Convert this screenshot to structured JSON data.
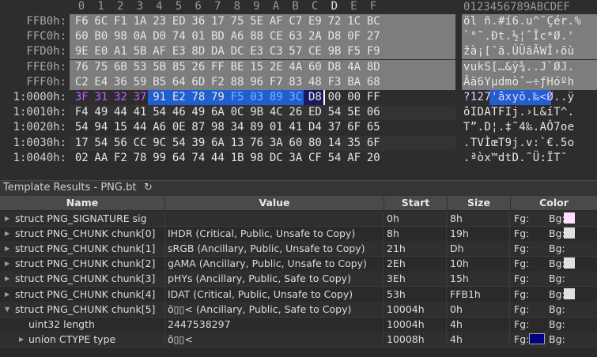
{
  "hex_header": {
    "columns": [
      "0",
      "1",
      "2",
      "3",
      "4",
      "5",
      "6",
      "7",
      "8",
      "9",
      "A",
      "B",
      "C",
      "D",
      "E",
      "F"
    ],
    "ascii_header": "0123456789ABCDEF"
  },
  "hex_rows": [
    {
      "addr": "FFB0h:",
      "bytes": [
        "F6",
        "6C",
        "F1",
        "1A",
        "23",
        "ED",
        "36",
        "17",
        "75",
        "5E",
        "AF",
        "C7",
        "E9",
        "72",
        "1C",
        "BC"
      ],
      "ascii": "öl ñ.#í6.u^¯Çér.%"
    },
    {
      "addr": "FFC0h:",
      "bytes": [
        "60",
        "B0",
        "98",
        "0A",
        "D0",
        "74",
        "01",
        "BD",
        "A6",
        "88",
        "CE",
        "63",
        "2A",
        "D8",
        "0F",
        "27"
      ],
      "ascii": "`°˜.Ðt.½¦ˆÎc*Ø.'"
    },
    {
      "addr": "FFD0h:",
      "bytes": [
        "9E",
        "E0",
        "A1",
        "5B",
        "AF",
        "E3",
        "8D",
        "DA",
        "DC",
        "E3",
        "C3",
        "57",
        "CE",
        "9B",
        "F5",
        "F9"
      ],
      "ascii": "žà¡[¯ã.ÚÜãÃWÎ›õù"
    },
    {
      "addr": "FFE0h:",
      "bytes": [
        "76",
        "75",
        "6B",
        "53",
        "5B",
        "85",
        "26",
        "FF",
        "BE",
        "15",
        "2E",
        "4A",
        "60",
        "D8",
        "4A",
        "8D"
      ],
      "ascii": "vukS[…&ÿ¾..J`ØJ."
    },
    {
      "addr": "FFF0h:",
      "bytes": [
        "C2",
        "E4",
        "36",
        "59",
        "B5",
        "64",
        "6D",
        "F2",
        "88",
        "96",
        "F7",
        "83",
        "48",
        "F3",
        "BA",
        "68"
      ],
      "ascii": "Âä6Yµdmòˆ–÷ƒHóºh"
    },
    {
      "addr": "1:0000h:",
      "bytes": [
        "3F",
        "31",
        "32",
        "37",
        "91",
        "E2",
        "78",
        "79",
        "F5",
        "03",
        "89",
        "3C",
        "D8",
        "00",
        "00",
        "FF"
      ],
      "ascii": "?127'âxyõ.‰<Ø..ÿ"
    },
    {
      "addr": "1:0010h:",
      "bytes": [
        "F4",
        "49",
        "44",
        "41",
        "54",
        "46",
        "49",
        "6A",
        "0C",
        "9B",
        "4C",
        "26",
        "ED",
        "54",
        "5E",
        "06"
      ],
      "ascii": "ôIDATFIj.›L&íT^."
    },
    {
      "addr": "1:0020h:",
      "bytes": [
        "54",
        "94",
        "15",
        "44",
        "A6",
        "0E",
        "87",
        "98",
        "34",
        "89",
        "01",
        "41",
        "D4",
        "37",
        "6F",
        "65"
      ],
      "ascii": "T”.D¦.‡˜4‰.AÔ7oe"
    },
    {
      "addr": "1:0030h:",
      "bytes": [
        "17",
        "54",
        "56",
        "CC",
        "9C",
        "54",
        "39",
        "6A",
        "13",
        "76",
        "3A",
        "60",
        "80",
        "14",
        "35",
        "6F"
      ],
      "ascii": ".TVÌœT9j.v:`€.5o"
    },
    {
      "addr": "1:0040h:",
      "bytes": [
        "02",
        "AA",
        "F2",
        "78",
        "99",
        "64",
        "74",
        "44",
        "1B",
        "98",
        "DC",
        "3A",
        "CF",
        "54",
        "AF",
        "20"
      ],
      "ascii": ".ªòx™dtD.˜Ü:ÏT¯ "
    }
  ],
  "template": {
    "title": "Template Results - PNG.bt",
    "refresh_icon": "↻",
    "columns": {
      "name": "Name",
      "value": "Value",
      "start": "Start",
      "size": "Size",
      "color": "Color"
    },
    "fg_label": "Fg:",
    "bg_label": "Bg:",
    "rows": [
      {
        "name": "struct PNG_SIGNATURE sig",
        "value": "",
        "start": "0h",
        "size": "8h",
        "bg": "#ffe0ff",
        "fg": ""
      },
      {
        "name": "struct PNG_CHUNK chunk[0]",
        "value": "IHDR  (Critical, Public, Unsafe to Copy)",
        "start": "8h",
        "size": "19h",
        "bg": "#e0e0e0",
        "fg": ""
      },
      {
        "name": "struct PNG_CHUNK chunk[1]",
        "value": "sRGB  (Ancillary, Public, Unsafe to Copy)",
        "start": "21h",
        "size": "Dh",
        "bg": "",
        "fg": ""
      },
      {
        "name": "struct PNG_CHUNK chunk[2]",
        "value": "gAMA  (Ancillary, Public, Unsafe to Copy)",
        "start": "2Eh",
        "size": "10h",
        "bg": "#e0e0e0",
        "fg": ""
      },
      {
        "name": "struct PNG_CHUNK chunk[3]",
        "value": "pHYs  (Ancillary, Public, Safe to Copy)",
        "start": "3Eh",
        "size": "15h",
        "bg": "",
        "fg": ""
      },
      {
        "name": "struct PNG_CHUNK chunk[4]",
        "value": "IDAT  (Critical, Public, Unsafe to Copy)",
        "start": "53h",
        "size": "FFB1h",
        "bg": "#e0e0e0",
        "fg": ""
      },
      {
        "name": "struct PNG_CHUNK chunk[5]",
        "value": "õ▯▯<  (Ancillary, Public, Safe to Copy)",
        "start": "10004h",
        "size": "0h",
        "bg": "",
        "fg": ""
      },
      {
        "name": "uint32 length",
        "value": "2447538297",
        "start": "10004h",
        "size": "4h",
        "bg": "",
        "fg": ""
      },
      {
        "name": "union CTYPE type",
        "value": "õ▯▯<",
        "start": "10008h",
        "size": "4h",
        "bg": "",
        "fg": "#000080"
      }
    ]
  },
  "colors": {
    "sig_highlight": "#ffe0ff",
    "chunk_highlight": "#e0e0e0",
    "selection_blue": "#1f5fd0",
    "purple_text": "#c060ff",
    "fg_swatch": "#000080"
  }
}
